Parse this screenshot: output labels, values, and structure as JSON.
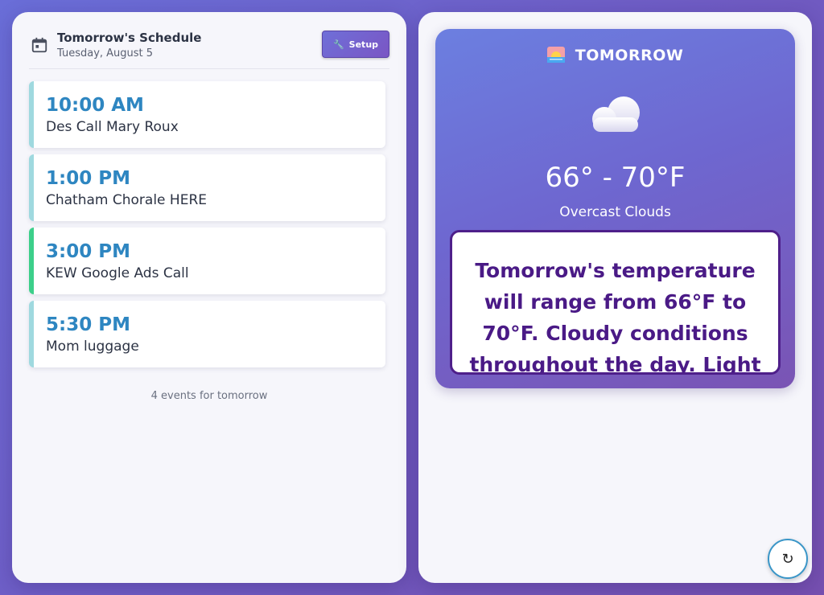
{
  "schedule": {
    "title": "Tomorrow's Schedule",
    "date": "Tuesday, August 5",
    "setup_label": "Setup",
    "events": [
      {
        "time": "10:00 AM",
        "title": "Des Call Mary Roux"
      },
      {
        "time": "1:00 PM",
        "title": "Chatham Chorale HERE"
      },
      {
        "time": "3:00 PM",
        "title": "KEW Google Ads Call"
      },
      {
        "time": "5:30 PM",
        "title": "Mom luggage"
      }
    ],
    "count_text": "4 events for tomorrow"
  },
  "weather": {
    "header": "TOMORROW",
    "temp_range": "66° - 70°F",
    "condition": "Overcast Clouds",
    "summary": "Tomorrow's temperature will range from 66°F to 70°F. Cloudy conditions throughout the day. Light"
  },
  "refresh_label": "↻",
  "colors": {
    "time_blue": "#2e86c1",
    "accent_purple": "#4a1a86",
    "event_border_default": "#9fd9df",
    "event_border_highlight": "#3ccf8a"
  },
  "icons": [
    "calendar-icon",
    "wrench-icon",
    "sunrise-icon",
    "cloud-icon",
    "refresh-icon"
  ]
}
